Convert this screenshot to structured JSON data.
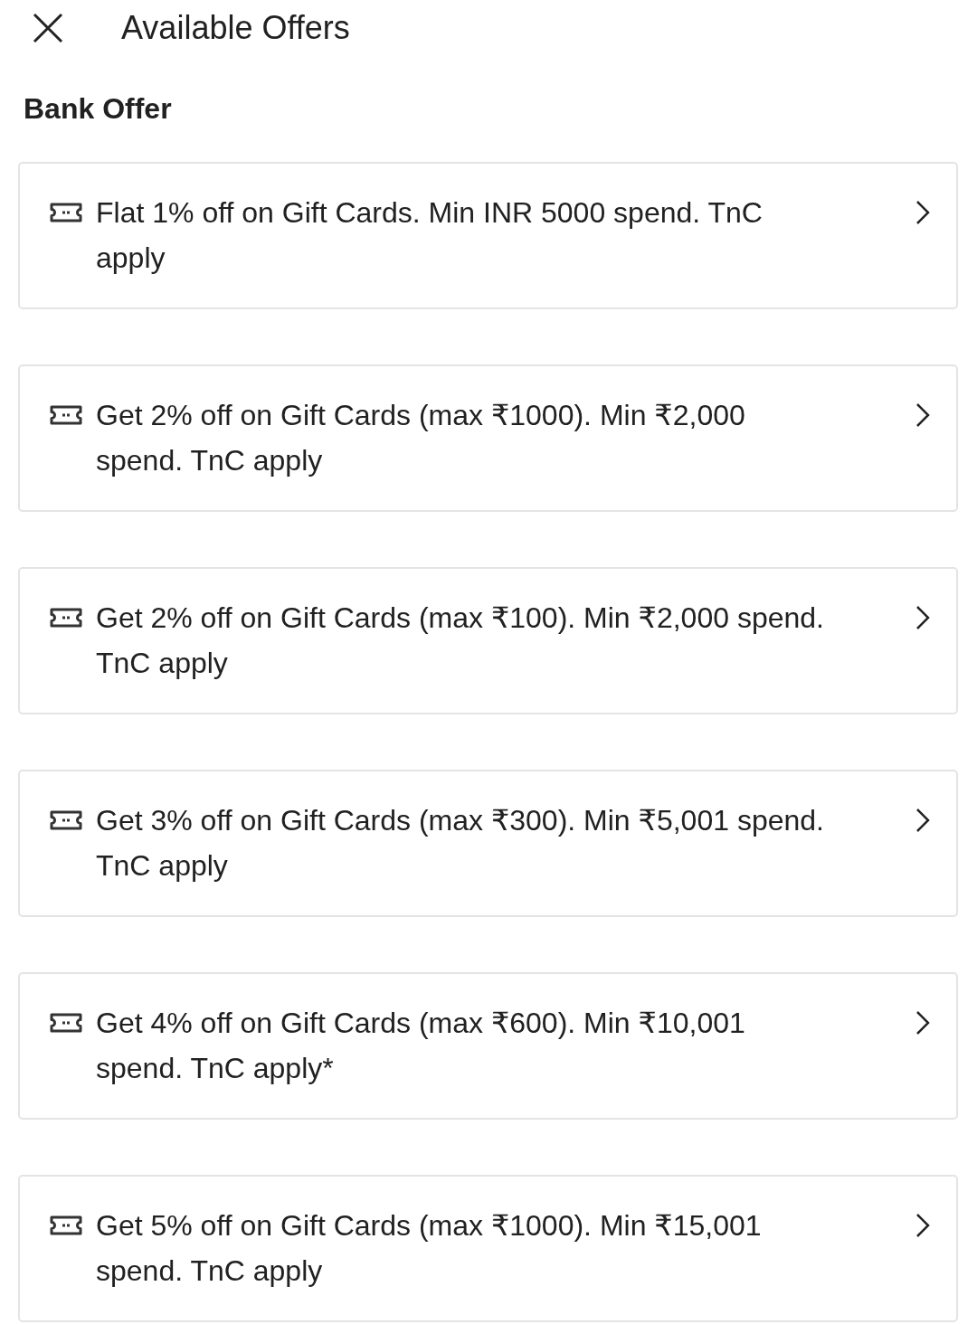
{
  "header": {
    "title": "Available Offers"
  },
  "section": {
    "title": "Bank Offer"
  },
  "offers": [
    {
      "text": "Flat 1% off on Gift Cards. Min INR 5000 spend. TnC apply"
    },
    {
      "text": "Get 2% off on Gift Cards (max ₹1000). Min ₹2,000 spend. TnC apply"
    },
    {
      "text": "Get 2% off on Gift Cards (max ₹100). Min ₹2,000 spend. TnC apply"
    },
    {
      "text": "Get 3% off on Gift Cards (max ₹300). Min ₹5,001 spend. TnC apply"
    },
    {
      "text": "Get 4% off on Gift Cards (max ₹600). Min ₹10,001 spend. TnC apply*"
    },
    {
      "text": "Get 5% off on Gift Cards (max ₹1000). Min ₹15,001 spend. TnC apply"
    }
  ]
}
